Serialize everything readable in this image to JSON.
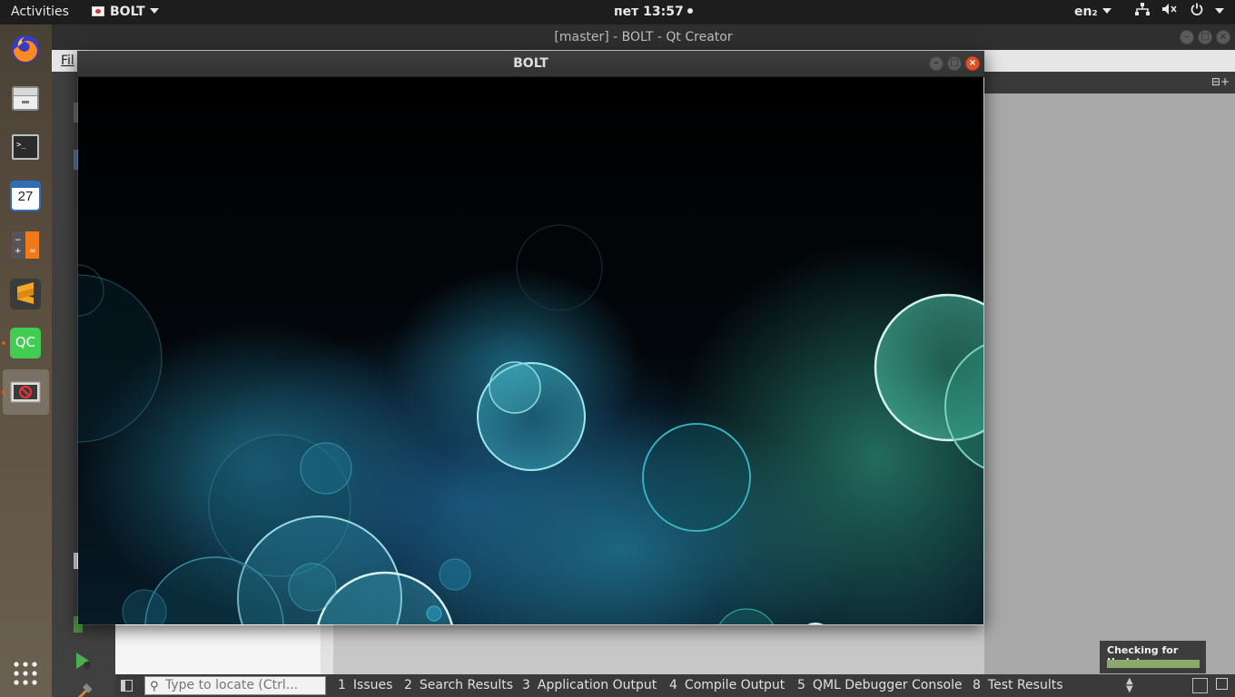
{
  "topbar": {
    "activities": "Activities",
    "app_name": "BOLT",
    "clock": "пет 13:57",
    "language": "en₂",
    "tray_icons": [
      "network-icon",
      "volume-muted-icon",
      "power-icon"
    ]
  },
  "dock": {
    "items": [
      {
        "name": "firefox",
        "icon": "firefox-icon"
      },
      {
        "name": "files",
        "icon": "files-icon"
      },
      {
        "name": "terminal",
        "icon": "terminal-icon"
      },
      {
        "name": "calendar",
        "icon": "calendar-icon",
        "label": "27"
      },
      {
        "name": "calculator",
        "icon": "calculator-icon"
      },
      {
        "name": "sublime-text",
        "icon": "sublime-icon"
      },
      {
        "name": "qt-creator",
        "icon": "qtcreator-icon",
        "label": "QC"
      },
      {
        "name": "bolt",
        "icon": "bolt-app-icon"
      }
    ],
    "show_apps_icon": "grid-icon"
  },
  "qt_creator": {
    "title": "[master] - BOLT - Qt Creator",
    "menu_first": "Fil",
    "locator_placeholder": "Type to locate (Ctrl...",
    "output_tabs": [
      {
        "num": "1",
        "label": "Issues"
      },
      {
        "num": "2",
        "label": "Search Results"
      },
      {
        "num": "3",
        "label": "Application Output"
      },
      {
        "num": "4",
        "label": "Compile Output"
      },
      {
        "num": "5",
        "label": "QML Debugger Console"
      },
      {
        "num": "8",
        "label": "Test Results"
      }
    ],
    "split_icon": "⊟+"
  },
  "updates": {
    "label": "Checking for Updates",
    "progress": 1.0
  },
  "bolt_window": {
    "title": "BOLT"
  },
  "colors": {
    "topbar": "#1d1d1d",
    "accent": "#e95420",
    "bubble": "#40c0d0"
  }
}
